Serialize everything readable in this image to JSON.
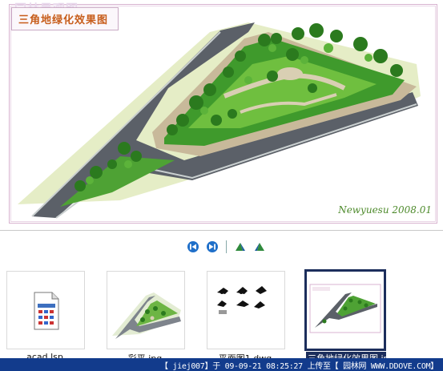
{
  "preview": {
    "title": "三角地绿化效果图",
    "watermark": "园林景观图",
    "signature": "Newyuesu 2008.01"
  },
  "toolbar": {
    "prev": "previous-icon",
    "next": "next-icon",
    "rotate_left": "rotate-left-icon",
    "rotate_right": "rotate-right-icon"
  },
  "files": [
    {
      "name": "acad.lsp",
      "type": "lsp"
    },
    {
      "name": "彩平.jpg",
      "type": "jpg"
    },
    {
      "name": "平面图1.dwg",
      "type": "dwg"
    },
    {
      "name": "三角地绿化效果图.jpg",
      "type": "jpg",
      "selected": true
    }
  ],
  "status_bar": {
    "text": "【 jiej007】于 09-09-21 08:25:27 上传至【 园林网 WWW.DDOVE.COM】"
  },
  "colors": {
    "selected_border": "#1c2e5c",
    "status_bg": "#123b8c",
    "grass": "#3f9a2c",
    "road": "#5a5f68"
  }
}
